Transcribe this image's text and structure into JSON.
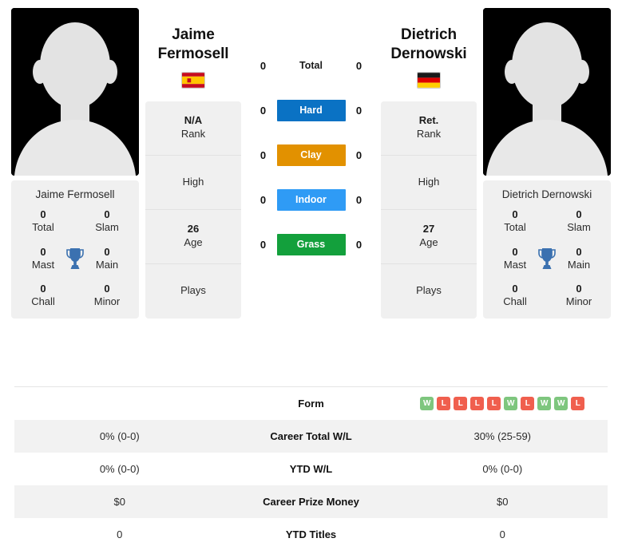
{
  "players": {
    "left": {
      "first_name": "Jaime",
      "last_name": "Fermosell",
      "full_name": "Jaime Fermosell",
      "country": "Spain",
      "flag_icon": "flag-spain",
      "avatar_icon": "player-avatar-placeholder",
      "rank_value": "N/A",
      "rank_label": "Rank",
      "high_label": "High",
      "high_value": "",
      "age_value": "26",
      "age_label": "Age",
      "plays_label": "Plays",
      "plays_value": "",
      "titles": [
        {
          "num": "0",
          "lbl": "Total"
        },
        {
          "num": "0",
          "lbl": "Slam"
        },
        {
          "num": "0",
          "lbl": "Mast"
        },
        {
          "num": "0",
          "lbl": "Main"
        },
        {
          "num": "0",
          "lbl": "Chall"
        },
        {
          "num": "0",
          "lbl": "Minor"
        }
      ]
    },
    "right": {
      "first_name": "Dietrich",
      "last_name": "Dernowski",
      "full_name": "Dietrich Dernowski",
      "country": "Germany",
      "flag_icon": "flag-germany",
      "avatar_icon": "player-avatar-placeholder",
      "rank_value": "Ret.",
      "rank_label": "Rank",
      "high_label": "High",
      "high_value": "",
      "age_value": "27",
      "age_label": "Age",
      "plays_label": "Plays",
      "plays_value": "",
      "titles": [
        {
          "num": "0",
          "lbl": "Total"
        },
        {
          "num": "0",
          "lbl": "Slam"
        },
        {
          "num": "0",
          "lbl": "Mast"
        },
        {
          "num": "0",
          "lbl": "Main"
        },
        {
          "num": "0",
          "lbl": "Chall"
        },
        {
          "num": "0",
          "lbl": "Minor"
        }
      ]
    }
  },
  "trophy_icon": "trophy-icon",
  "h2h": {
    "rows": [
      {
        "left": "0",
        "label": "Total",
        "right": "0",
        "color": ""
      },
      {
        "left": "0",
        "label": "Hard",
        "right": "0",
        "color": "#0a72c4"
      },
      {
        "left": "0",
        "label": "Clay",
        "right": "0",
        "color": "#e29100"
      },
      {
        "left": "0",
        "label": "Indoor",
        "right": "0",
        "color": "#2f9bf5"
      },
      {
        "left": "0",
        "label": "Grass",
        "right": "0",
        "color": "#13a03c"
      }
    ]
  },
  "stats_table": {
    "rows": [
      {
        "label": "Form",
        "left_value": "",
        "right_value": "",
        "left_form": [],
        "right_form": [
          "W",
          "L",
          "L",
          "L",
          "L",
          "W",
          "L",
          "W",
          "W",
          "L"
        ]
      },
      {
        "label": "Career Total W/L",
        "left_value": "0% (0-0)",
        "right_value": "30% (25-59)",
        "left_form": [],
        "right_form": []
      },
      {
        "label": "YTD W/L",
        "left_value": "0% (0-0)",
        "right_value": "0% (0-0)",
        "left_form": [],
        "right_form": []
      },
      {
        "label": "Career Prize Money",
        "left_value": "$0",
        "right_value": "$0",
        "left_form": [],
        "right_form": []
      },
      {
        "label": "YTD Titles",
        "left_value": "0",
        "right_value": "0",
        "left_form": [],
        "right_form": []
      }
    ]
  },
  "colors": {
    "hard": "#0a72c4",
    "clay": "#e29100",
    "indoor": "#2f9bf5",
    "grass": "#13a03c",
    "win": "#7ec67e",
    "loss": "#f05f4e",
    "card_bg": "#f0f0f0",
    "stripe_bg": "#f2f2f2"
  }
}
